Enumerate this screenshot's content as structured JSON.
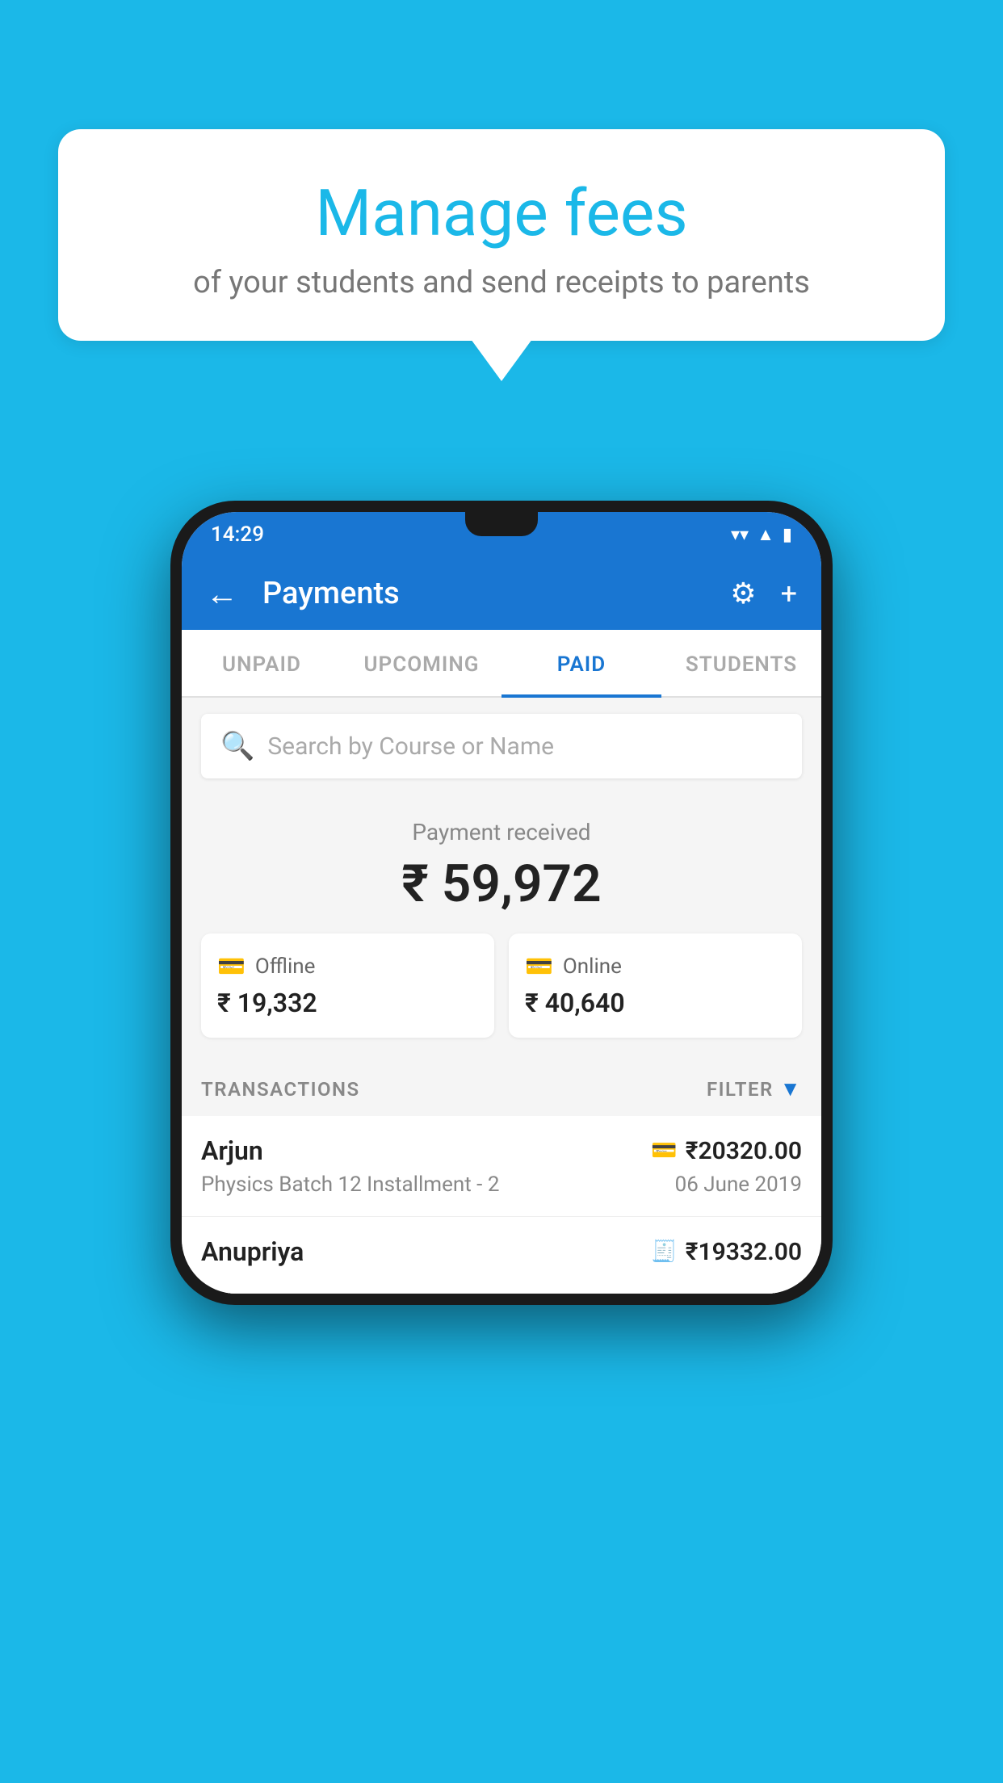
{
  "background_color": "#1bb8e8",
  "speech_bubble": {
    "title": "Manage fees",
    "subtitle": "of your students and send receipts to parents"
  },
  "phone": {
    "status_bar": {
      "time": "14:29",
      "icons": [
        "wifi",
        "signal",
        "battery"
      ]
    },
    "app_bar": {
      "title": "Payments",
      "back_icon": "←",
      "settings_icon": "⚙",
      "add_icon": "+"
    },
    "tabs": [
      {
        "label": "UNPAID",
        "active": false
      },
      {
        "label": "UPCOMING",
        "active": false
      },
      {
        "label": "PAID",
        "active": true
      },
      {
        "label": "STUDENTS",
        "active": false
      }
    ],
    "search": {
      "placeholder": "Search by Course or Name"
    },
    "payment_summary": {
      "label": "Payment received",
      "total": "₹ 59,972",
      "offline": {
        "label": "Offline",
        "amount": "₹ 19,332"
      },
      "online": {
        "label": "Online",
        "amount": "₹ 40,640"
      }
    },
    "transactions": {
      "header_label": "TRANSACTIONS",
      "filter_label": "FILTER",
      "items": [
        {
          "name": "Arjun",
          "amount": "₹20320.00",
          "course": "Physics Batch 12 Installment - 2",
          "date": "06 June 2019",
          "payment_type": "card"
        },
        {
          "name": "Anupriya",
          "amount": "₹19332.00",
          "course": "",
          "date": "",
          "payment_type": "cash"
        }
      ]
    }
  }
}
